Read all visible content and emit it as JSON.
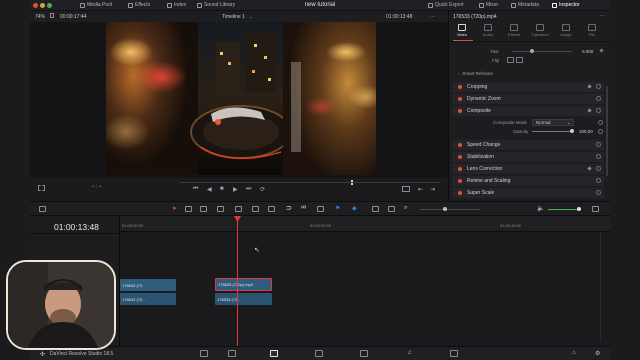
{
  "topbar": {
    "items": [
      "Media Pool",
      "Effects",
      "Index",
      "Sound Library"
    ],
    "title": "new tutorial",
    "right_items": [
      "Quick Export",
      "Mixer",
      "Metadata",
      "Inspector"
    ]
  },
  "viewer": {
    "zoom": "74%",
    "timecode_left": "00:00:17:44",
    "timeline_name": "Timeline 1",
    "timecode_right": "01:00:13:48"
  },
  "inspector": {
    "clip_name": "176533 (720p).mp4",
    "tabs": [
      "Video",
      "Audio",
      "Effects",
      "Transition",
      "Image",
      "File"
    ],
    "yaw_label": "Yaw",
    "yaw_value": "0.000",
    "flip_label": "Flip",
    "smart_reframe": "Smart Reframe",
    "sections": [
      "Cropping",
      "Dynamic Zoom",
      "Composite",
      "Speed Change",
      "Stabilization",
      "Lens Correction",
      "Retime and Scaling",
      "Super Scale"
    ],
    "composite_mode_label": "Composite Mode",
    "composite_mode_value": "Normal",
    "opacity_label": "Opacity",
    "opacity_value": "100.00"
  },
  "timeline": {
    "timecode": "01:00:13:48",
    "ruler_labels": [
      "01:00:00:00",
      "01:00:22:00",
      "01:00:44:00"
    ],
    "clips_top": [
      "176533 (72...",
      "176533 (720p).mp4"
    ],
    "clips_bottom": [
      "176533 (72...",
      "176533 (72..."
    ]
  },
  "bottombar": {
    "app_name": "DaVinci Resolve Studio 18.5"
  },
  "colors": {
    "accent_red": "#e0503c",
    "playhead": "#e23a3a",
    "clip_blue": "#2f5d7d",
    "clip_selected_border": "#e23a3a"
  }
}
